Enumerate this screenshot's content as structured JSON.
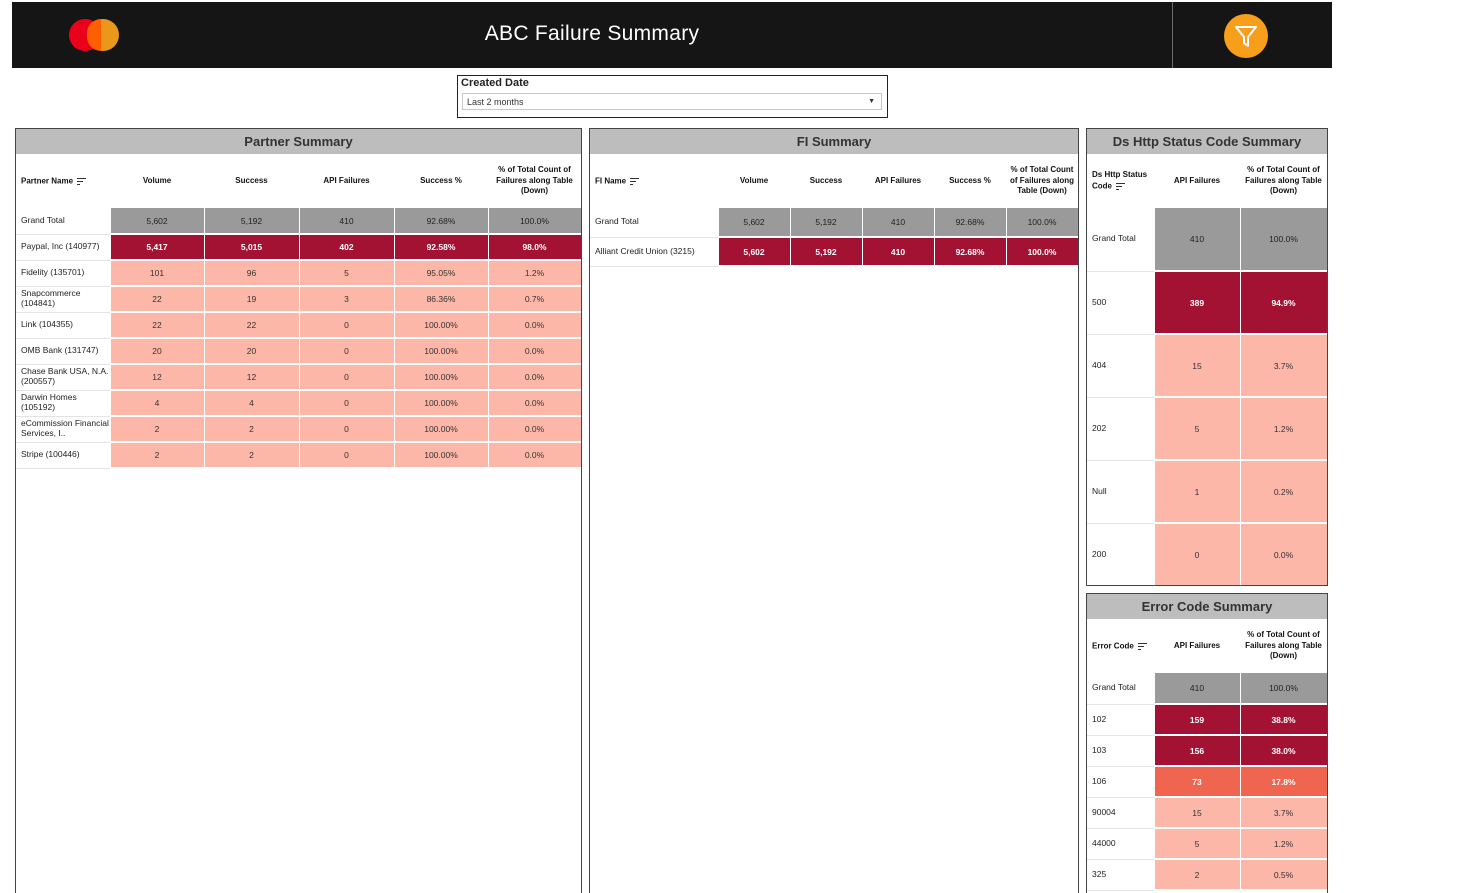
{
  "header": {
    "title": "ABC Failure Summary"
  },
  "date_filter": {
    "label": "Created Date",
    "value": "Last 2 months"
  },
  "partner_summary": {
    "title": "Partner Summary",
    "headers": [
      "Partner Name",
      "Volume",
      "Success",
      "API Failures",
      "Success %",
      "% of Total Count of Failures along Table (Down)"
    ],
    "grand_total": [
      "Grand Total",
      "5,602",
      "5,192",
      "410",
      "92.68%",
      "100.0%"
    ],
    "rows": [
      [
        "Paypal, Inc (140977)",
        "5,417",
        "5,015",
        "402",
        "92.58%",
        "98.0%"
      ],
      [
        "Fidelity (135701)",
        "101",
        "96",
        "5",
        "95.05%",
        "1.2%"
      ],
      [
        "Snapcommerce (104841)",
        "22",
        "19",
        "3",
        "86.36%",
        "0.7%"
      ],
      [
        "Link (104355)",
        "22",
        "22",
        "0",
        "100.00%",
        "0.0%"
      ],
      [
        "OMB Bank (131747)",
        "20",
        "20",
        "0",
        "100.00%",
        "0.0%"
      ],
      [
        "Chase Bank USA, N.A. (200557)",
        "12",
        "12",
        "0",
        "100.00%",
        "0.0%"
      ],
      [
        "Darwin Homes (105192)",
        "4",
        "4",
        "0",
        "100.00%",
        "0.0%"
      ],
      [
        "eCommission Financial Services, I..",
        "2",
        "2",
        "0",
        "100.00%",
        "0.0%"
      ],
      [
        "Stripe (100446)",
        "2",
        "2",
        "0",
        "100.00%",
        "0.0%"
      ]
    ]
  },
  "fi_summary": {
    "title": "FI Summary",
    "headers": [
      "FI Name",
      "Volume",
      "Success",
      "API Failures",
      "Success %",
      "% of Total Count of Failures along Table (Down)"
    ],
    "grand_total": [
      "Grand Total",
      "5,602",
      "5,192",
      "410",
      "92.68%",
      "100.0%"
    ],
    "rows": [
      [
        "Alliant Credit Union (3215)",
        "5,602",
        "5,192",
        "410",
        "92.68%",
        "100.0%"
      ]
    ]
  },
  "http_summary": {
    "title": "Ds Http Status Code Summary",
    "headers": [
      "Ds Http Status Code",
      "API Failures",
      "% of Total Count of Failures along Table (Down)"
    ],
    "grand_total": [
      "Grand Total",
      "410",
      "100.0%"
    ],
    "rows": [
      [
        "500",
        "389",
        "94.9%"
      ],
      [
        "404",
        "15",
        "3.7%"
      ],
      [
        "202",
        "5",
        "1.2%"
      ],
      [
        "Null",
        "1",
        "0.2%"
      ],
      [
        "200",
        "0",
        "0.0%"
      ]
    ]
  },
  "error_summary": {
    "title": "Error Code Summary",
    "headers": [
      "Error Code",
      "API Failures",
      "% of Total Count of Failures along Table (Down)"
    ],
    "grand_total": [
      "Grand Total",
      "410",
      "100.0%"
    ],
    "rows": [
      [
        "102",
        "159",
        "38.8%"
      ],
      [
        "103",
        "156",
        "38.0%"
      ],
      [
        "106",
        "73",
        "17.8%"
      ],
      [
        "90004",
        "15",
        "3.7%"
      ],
      [
        "44000",
        "5",
        "1.2%"
      ],
      [
        "325",
        "2",
        "0.5%"
      ]
    ]
  },
  "colors": {
    "dark": "#a31233",
    "medium": "#f0654f",
    "light": "#fdb7a8",
    "total": "#9a9a9a",
    "header_bg": "#151515",
    "accent": "#f79e1b"
  }
}
